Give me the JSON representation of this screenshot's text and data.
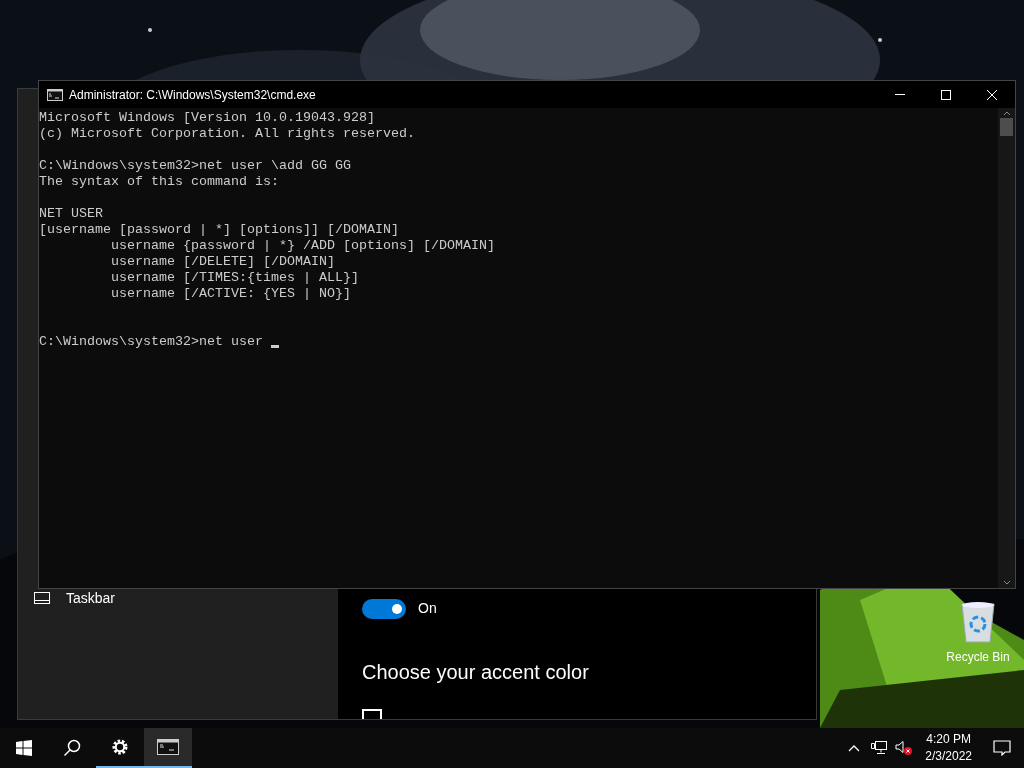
{
  "console_window": {
    "title": "Administrator: C:\\Windows\\System32\\cmd.exe",
    "blocks": [
      [
        "Microsoft Windows [Version 10.0.19043.928]",
        "(c) Microsoft Corporation. All rights reserved."
      ],
      [
        "C:\\Windows\\system32>net user \\add GG GG",
        "The syntax of this command is:"
      ],
      [
        "NET USER",
        "[username [password | *] [options]] [/DOMAIN]",
        "         username {password | *} /ADD [options] [/DOMAIN]",
        "         username [/DELETE] [/DOMAIN]",
        "         username [/TIMES:{times | ALL}]",
        "         username [/ACTIVE: {YES | NO}]"
      ]
    ],
    "prompt": "C:\\Windows\\system32>net user ",
    "cursor": true
  },
  "settings_window": {
    "nav_items": [
      {
        "label": "Taskbar",
        "selected": false
      }
    ],
    "transparency_toggle": {
      "on": true,
      "label": "On"
    },
    "heading": "Choose your accent color",
    "accent_checkbox": {
      "checked": false
    }
  },
  "desktop_icons": [
    {
      "label": "Recycle Bin"
    }
  ],
  "taskbar": {
    "apps": [
      {
        "kind": "settings",
        "running": true,
        "selected": false
      },
      {
        "kind": "console",
        "running": true,
        "selected": true
      }
    ],
    "time": "4:20 PM",
    "date": "2/3/2022"
  }
}
